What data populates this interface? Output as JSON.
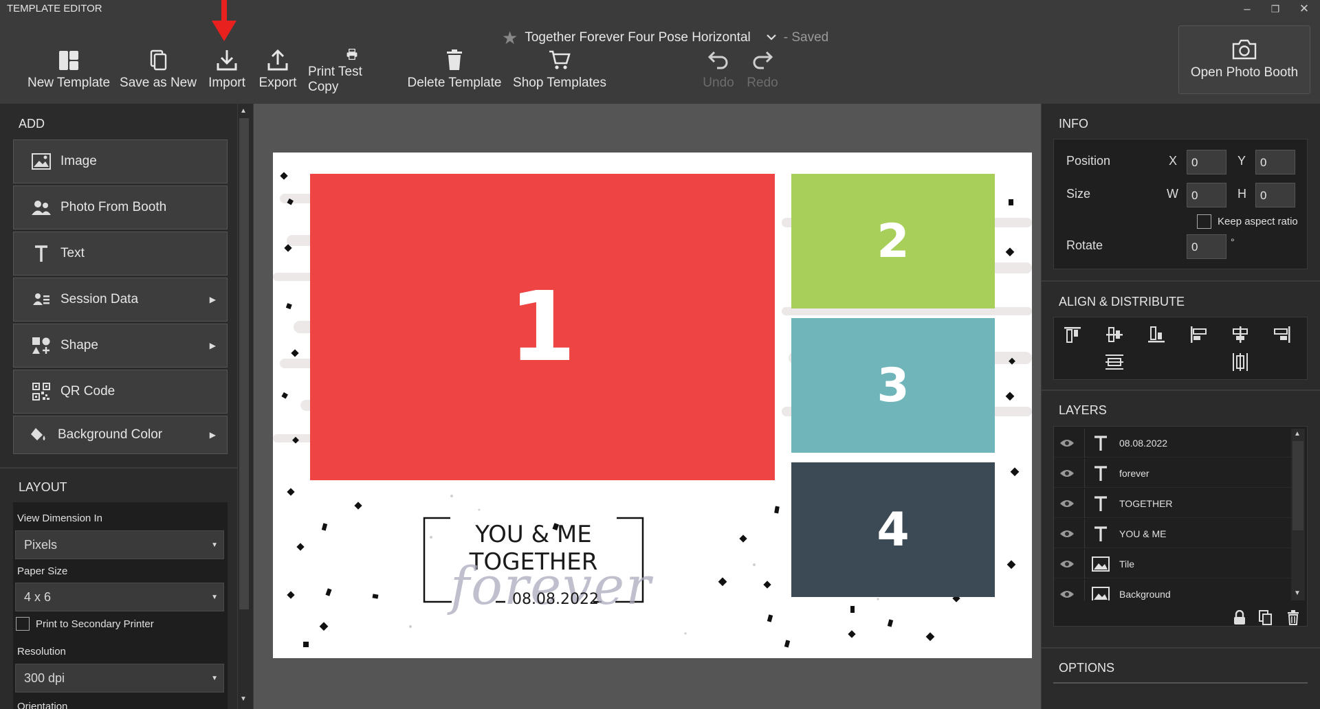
{
  "app": {
    "title": "TEMPLATE EDITOR"
  },
  "window_controls": {
    "minimize": "–",
    "restore": "❐",
    "close": "✕"
  },
  "document": {
    "star": "★",
    "name": "Together Forever Four Pose Horizontal",
    "status": "- Saved"
  },
  "toolbar": {
    "new": "New Template",
    "save_as_new": "Save as New",
    "import": "Import",
    "export": "Export",
    "print_test": "Print Test Copy",
    "delete": "Delete Template",
    "shop": "Shop Templates",
    "undo": "Undo",
    "redo": "Redo"
  },
  "booth": {
    "label": "Open Photo Booth"
  },
  "add": {
    "header": "ADD",
    "items": [
      {
        "label": "Image",
        "icon": "image-icon"
      },
      {
        "label": "Photo From Booth",
        "icon": "people-icon"
      },
      {
        "label": "Text",
        "icon": "text-icon"
      },
      {
        "label": "Session Data",
        "icon": "session-icon",
        "submenu": "▶"
      },
      {
        "label": "Shape",
        "icon": "shape-icon",
        "submenu": "▶"
      },
      {
        "label": "QR Code",
        "icon": "qr-icon"
      },
      {
        "label": "Background Color",
        "icon": "paint-bucket-icon",
        "submenu": "▶"
      }
    ]
  },
  "layout": {
    "header": "LAYOUT",
    "view_dim_label": "View Dimension In",
    "view_dim_value": "Pixels",
    "paper_label": "Paper Size",
    "paper_value": "4 x 6",
    "secondary_label": "Print to Secondary Printer",
    "resolution_label": "Resolution",
    "resolution_value": "300 dpi",
    "orientation_label": "Orientation"
  },
  "canvas": {
    "slots": [
      {
        "num": "1",
        "color": "#ee4444"
      },
      {
        "num": "2",
        "color": "#a8cf5a"
      },
      {
        "num": "3",
        "color": "#6fb5b9"
      },
      {
        "num": "4",
        "color": "#3b4a54"
      }
    ],
    "text1": "YOU & ME",
    "text2": "TOGETHER",
    "script": "forever",
    "date": "08.08.2022"
  },
  "info": {
    "header": "INFO",
    "position_label": "Position",
    "x_label": "X",
    "x": "0",
    "y_label": "Y",
    "y": "0",
    "size_label": "Size",
    "w_label": "W",
    "w": "0",
    "h_label": "H",
    "h": "0",
    "keep_label": "Keep aspect ratio",
    "rotate_label": "Rotate",
    "rotate": "0",
    "deg": "°"
  },
  "align": {
    "header": "ALIGN & DISTRIBUTE"
  },
  "layers": {
    "header": "LAYERS",
    "items": [
      {
        "name": "08.08.2022",
        "type": "text-icon"
      },
      {
        "name": "forever",
        "type": "text-icon"
      },
      {
        "name": "TOGETHER",
        "type": "text-icon"
      },
      {
        "name": "YOU & ME",
        "type": "text-icon"
      },
      {
        "name": "Tile",
        "type": "image-icon"
      },
      {
        "name": "Background",
        "type": "image-icon"
      }
    ]
  },
  "options": {
    "header": "OPTIONS"
  },
  "colors": {
    "accent_arrow": "#e8211e",
    "bg": "#3b3b3b",
    "panel": "#2b2b2b"
  }
}
